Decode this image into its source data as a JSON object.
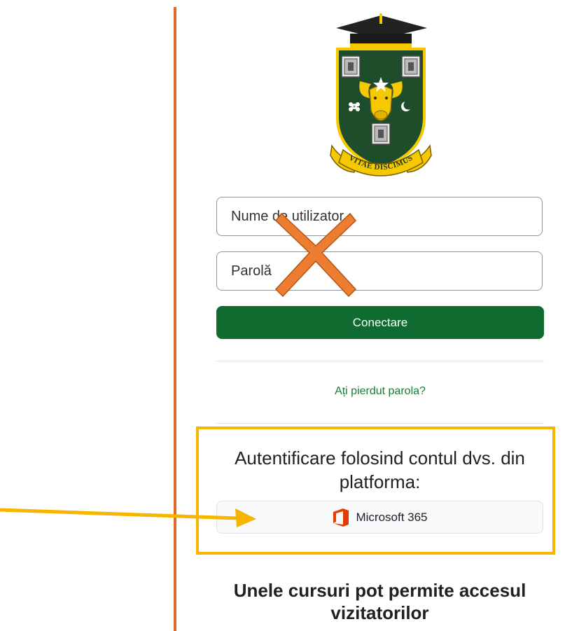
{
  "colors": {
    "accent_orange": "#e06a2c",
    "brand_green": "#0f6b30",
    "link_green": "#1a7a3a",
    "highlight_yellow": "#f7b500",
    "x_mark_orange": "#ed7d31",
    "crest_green": "#1e4d2b",
    "crest_gold": "#f5c800"
  },
  "logo": {
    "motto": "VITAE DISCIMUS"
  },
  "login": {
    "username_placeholder": "Nume de utilizator",
    "password_placeholder": "Parolă",
    "submit_label": "Conectare",
    "lost_password_link": "Ați pierdut parola?"
  },
  "oauth": {
    "heading": "Autentificare folosind contul dvs. din platforma:",
    "provider_label": "Microsoft 365",
    "provider_icon": "office-icon"
  },
  "guest": {
    "heading": "Unele cursuri pot permite accesul vizitatorilor"
  },
  "annotations": {
    "x_mark_icon": "cross-mark-icon",
    "arrow_icon": "arrow-right-icon"
  }
}
